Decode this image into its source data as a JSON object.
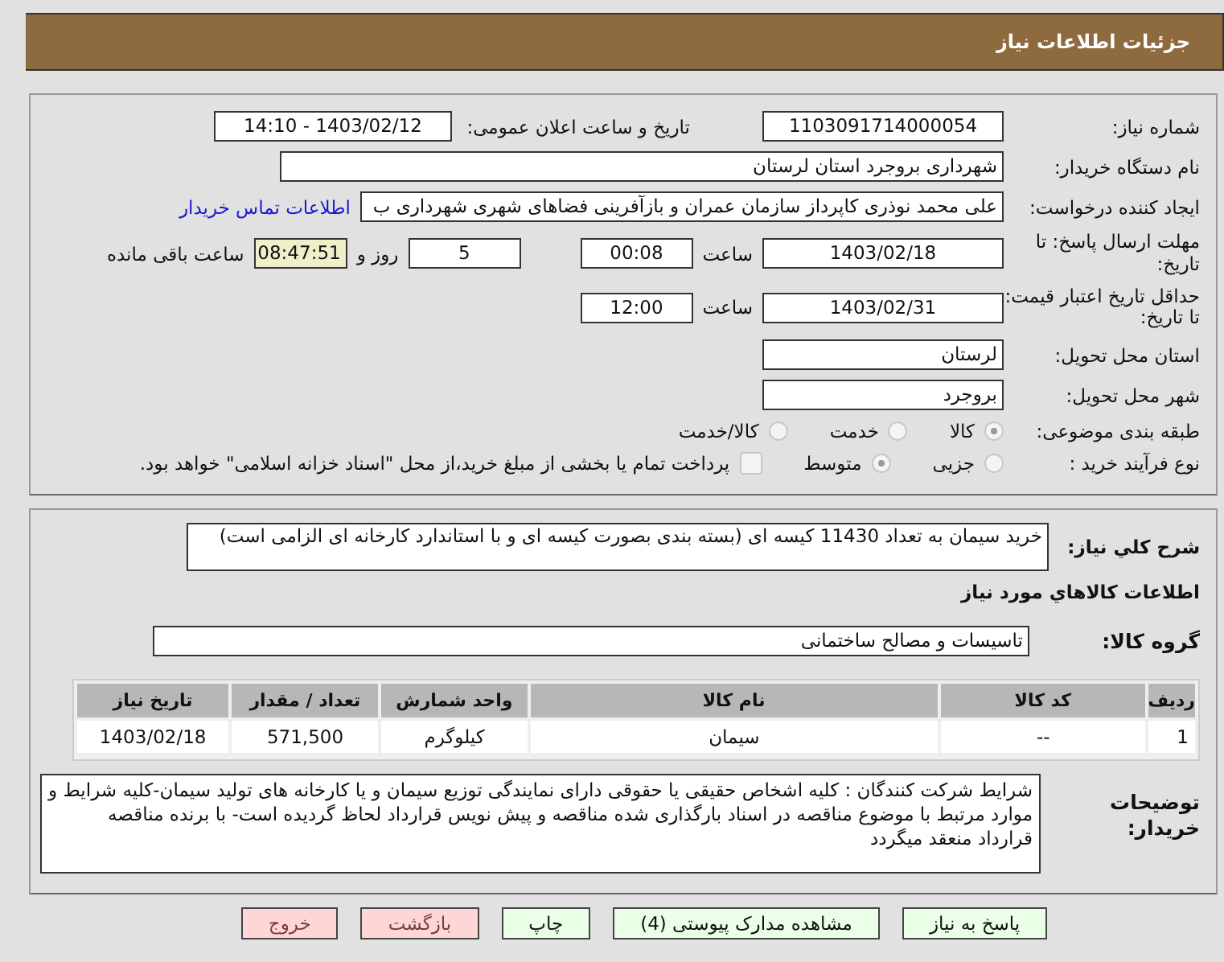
{
  "header": {
    "title": "جزئیات اطلاعات نیاز"
  },
  "need_number": {
    "label": "شماره نیاز:",
    "value": "1103091714000054"
  },
  "announce": {
    "label": "تاریخ و ساعت اعلان عمومی:",
    "value": "1403/02/12 - 14:10"
  },
  "buyer": {
    "label": "نام دستگاه خریدار:",
    "value": "شهرداری بروجرد استان لرستان"
  },
  "creator": {
    "label": "ایجاد کننده درخواست:",
    "value": "علی محمد نوذری کاپرداز سازمان عمران و بازآفرینی فضاهای شهری شهرداری ب",
    "link": "اطلاعات تماس خریدار"
  },
  "deadline": {
    "label": "مهلت ارسال پاسخ: تا تاریخ:",
    "date": "1403/02/18",
    "time_label": "ساعت",
    "time": "00:08",
    "days": "5",
    "days_label": "روز و",
    "remaining": "08:47:51",
    "remaining_label": "ساعت باقی مانده"
  },
  "validity": {
    "label": "حداقل تاریخ اعتبار قیمت: تا تاریخ:",
    "date": "1403/02/31",
    "time_label": "ساعت",
    "time": "12:00"
  },
  "province": {
    "label": "استان محل تحویل:",
    "value": "لرستان"
  },
  "city": {
    "label": "شهر محل تحویل:",
    "value": "بروجرد"
  },
  "category": {
    "label": "طبقه بندی موضوعی:",
    "options": [
      {
        "label": "کالا",
        "selected": true
      },
      {
        "label": "خدمت",
        "selected": false
      },
      {
        "label": "کالا/خدمت",
        "selected": false
      }
    ]
  },
  "process": {
    "label": "نوع فرآیند خرید :",
    "options": [
      {
        "label": "جزیی",
        "selected": false
      },
      {
        "label": "متوسط",
        "selected": true
      }
    ],
    "payment": {
      "checked": false,
      "text": "پرداخت تمام یا بخشی از مبلغ خرید،از محل \"اسناد خزانه اسلامی\" خواهد بود."
    }
  },
  "description": {
    "label": "شرح كلي نياز:",
    "value": "خرید سیمان به تعداد 11430 کیسه ای (بسته بندی بصورت کیسه ای و با استاندارد کارخانه ای الزامی است)"
  },
  "goods_title": "اطلاعات كالاهاي مورد نياز",
  "goods_group": {
    "label": "گروه کالا:",
    "value": "تاسیسات و مصالح ساختمانی"
  },
  "table": {
    "columns": [
      "ردیف",
      "کد کالا",
      "نام کالا",
      "واحد شمارش",
      "تعداد / مقدار",
      "تاریخ نیاز"
    ],
    "rows": [
      [
        "1",
        "--",
        "سیمان",
        "کیلوگرم",
        "571,500",
        "1403/02/18"
      ]
    ]
  },
  "notes": {
    "label": "توضیحات خریدار:",
    "value": "شرایط شرکت کنندگان : کلیه اشخاص حقیقی یا حقوقی دارای نمایندگی توزیع سیمان و یا کارخانه های تولید سیمان-کلیه شرایط و موارد مرتبط با موضوع مناقصه در اسناد بارگذاری شده مناقصه و پیش نویس قرارداد لحاظ گردیده است- با برنده مناقصه قرارداد منعقد میگردد"
  },
  "buttons": [
    {
      "label": "پاسخ به نیاز",
      "kind": "action"
    },
    {
      "label": "مشاهده مدارک پیوستی (4)",
      "kind": "action"
    },
    {
      "label": "چاپ",
      "kind": "action"
    },
    {
      "label": "بازگشت",
      "kind": "exit"
    },
    {
      "label": "خروج",
      "kind": "exit"
    }
  ]
}
